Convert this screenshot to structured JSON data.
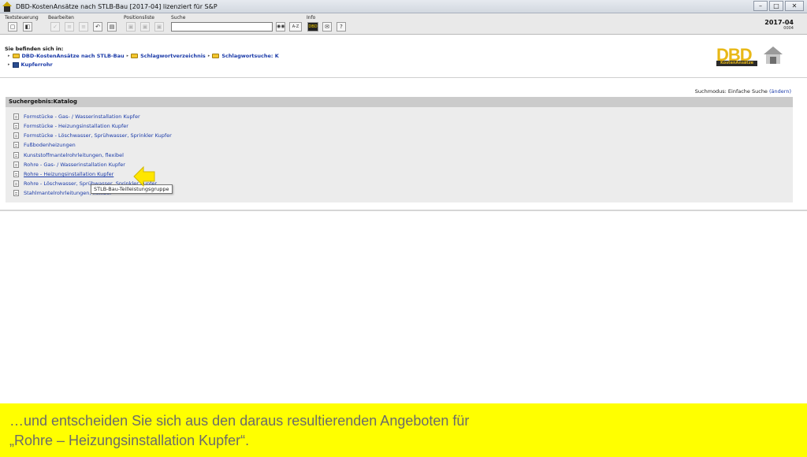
{
  "window": {
    "title": "DBD-KostenAnsätze nach STLB-Bau [2017-04] lizenziert für S&P",
    "minimize": "–",
    "maximize": "□",
    "close": "✕"
  },
  "toolbar": {
    "menu_textsteuerung": "Textsteuerung",
    "menu_bearbeiten": "Bearbeiten",
    "menu_positionsliste": "Positionsliste",
    "menu_suche": "Suche",
    "menu_info": "Info",
    "search_value": "",
    "search_button_label": "A-Z",
    "version": "2017-04",
    "version_code": "0004"
  },
  "breadcrumb": {
    "title": "Sie befinden sich in:",
    "items": [
      "DBD-KostenAnsätze nach STLB-Bau",
      "Schlagwortverzeichnis",
      "Schlagwortsuche: K",
      "Kupferrohr"
    ]
  },
  "logo": {
    "text": "DBD",
    "subtitle": "KostenAnsätze"
  },
  "search_mode": {
    "label": "Suchmodus: Einfache Suche",
    "change_link": "(ändern)"
  },
  "results": {
    "header": "Suchergebnis:Katalog",
    "items": [
      "Formstücke - Gas- / Wasserinstallation Kupfer",
      "Formstücke - Heizungsinstallation Kupfer",
      "Formstücke - Löschwasser, Sprühwasser, Sprinkler Kupfer",
      "Fußbodenheizungen",
      "Kunststoffmantelrohrleitungen, flexibel",
      "Rohre - Gas- / Wasserinstallation Kupfer",
      "Rohre - Heizungsinstallation Kupfer",
      "Rohre - Löschwasser, Sprühwasser, Sprinkler Kupfer",
      "Stahlmantelrohrleitungen, flexibel"
    ],
    "hovered_index": 6,
    "tooltip": "STLB-Bau-Teilleistungsgruppe"
  },
  "caption": {
    "line1": "…und entscheiden Sie sich aus den daraus resultierenden Angeboten für",
    "line2": "„Rohre – Heizungsinstallation Kupfer“."
  },
  "colors": {
    "link": "#1a3aa8",
    "caption_bg": "#ffff00",
    "caption_text": "#6b6b6b",
    "pointer": "#ffe600"
  }
}
